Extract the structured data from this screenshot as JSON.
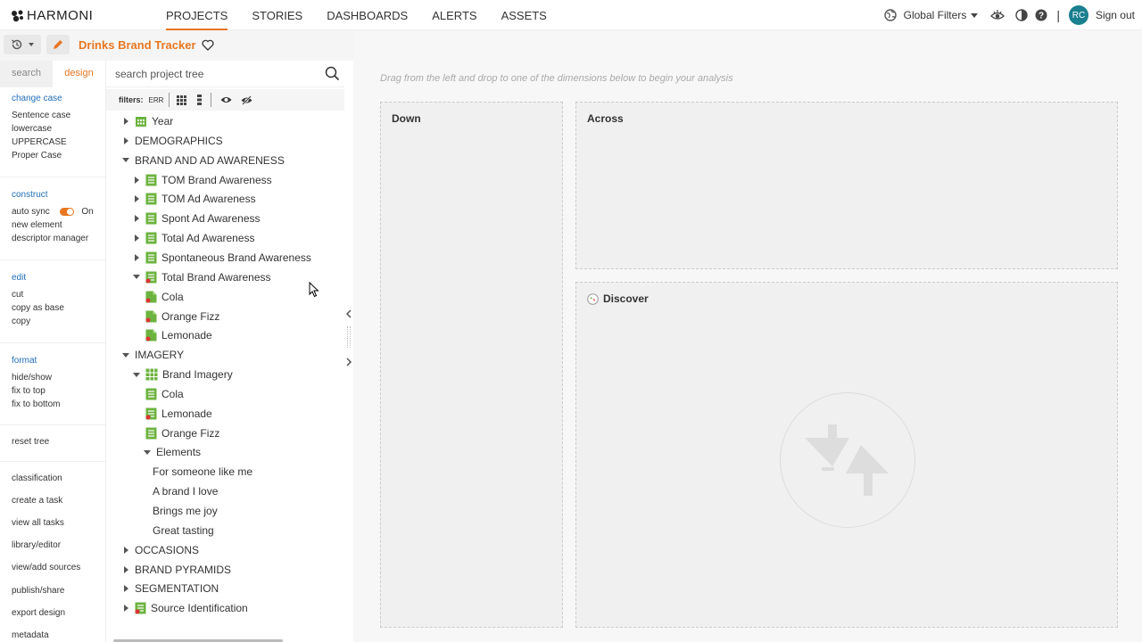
{
  "app": {
    "logo_text": "HARMONI"
  },
  "nav": {
    "tabs": [
      {
        "label": "PROJECTS",
        "active": true
      },
      {
        "label": "STORIES",
        "active": false
      },
      {
        "label": "DASHBOARDS",
        "active": false
      },
      {
        "label": "ALERTS",
        "active": false
      },
      {
        "label": "ASSETS",
        "active": false
      }
    ],
    "global_filters": "Global Filters",
    "separator": "|",
    "user_initials": "RC",
    "sign_out": "Sign out"
  },
  "project": {
    "title": "Drinks Brand Tracker"
  },
  "left_tabs": {
    "search": "search",
    "design": "design"
  },
  "left_menu": {
    "change_case": {
      "head": "change case",
      "items": [
        "Sentence case",
        "lowercase",
        "UPPERCASE",
        "Proper Case"
      ]
    },
    "construct": {
      "head": "construct",
      "auto_sync": "auto sync",
      "auto_sync_state": "On",
      "items": [
        "new element",
        "descriptor manager"
      ]
    },
    "edit": {
      "head": "edit",
      "items": [
        "cut",
        "copy as base",
        "copy"
      ]
    },
    "format": {
      "head": "format",
      "items": [
        "hide/show",
        "fix to top",
        "fix to bottom"
      ]
    },
    "reset_tree": "reset tree",
    "actions": [
      "classification",
      "create a task",
      "view all tasks",
      "library/editor",
      "view/add sources",
      "publish/share",
      "export design",
      "metadata"
    ]
  },
  "tree_search": {
    "placeholder": "search project tree"
  },
  "filters": {
    "label": "filters:",
    "err": "ERR"
  },
  "tree": [
    {
      "label": "Year",
      "arrow": "right",
      "icon": "calendar"
    },
    {
      "label": "DEMOGRAPHICS",
      "arrow": "right",
      "icon": ""
    },
    {
      "label": "BRAND AND AD AWARENESS",
      "arrow": "down",
      "icon": ""
    },
    {
      "label": "TOM Brand Awareness",
      "arrow": "right",
      "icon": "list"
    },
    {
      "label": "TOM Ad Awareness",
      "arrow": "right",
      "icon": "list"
    },
    {
      "label": "Spont Ad Awareness",
      "arrow": "right",
      "icon": "list"
    },
    {
      "label": "Total Ad Awareness",
      "arrow": "right",
      "icon": "list"
    },
    {
      "label": "Spontaneous Brand Awareness",
      "arrow": "right",
      "icon": "list"
    },
    {
      "label": "Total Brand Awareness",
      "arrow": "down",
      "icon": "list-dot"
    },
    {
      "label": "Cola",
      "arrow": "",
      "icon": "doc"
    },
    {
      "label": "Orange Fizz",
      "arrow": "",
      "icon": "doc"
    },
    {
      "label": "Lemonade",
      "arrow": "",
      "icon": "doc"
    },
    {
      "label": "IMAGERY",
      "arrow": "down",
      "icon": ""
    },
    {
      "label": "Brand Imagery",
      "arrow": "down",
      "icon": "grid"
    },
    {
      "label": "Cola",
      "arrow": "",
      "icon": "list"
    },
    {
      "label": "Lemonade",
      "arrow": "",
      "icon": "list-dot"
    },
    {
      "label": "Orange Fizz",
      "arrow": "",
      "icon": "list"
    },
    {
      "label": "Elements",
      "arrow": "down",
      "icon": ""
    },
    {
      "label": "For someone like me",
      "arrow": "",
      "icon": ""
    },
    {
      "label": "A brand I love",
      "arrow": "",
      "icon": ""
    },
    {
      "label": "Brings me joy",
      "arrow": "",
      "icon": ""
    },
    {
      "label": "Great tasting",
      "arrow": "",
      "icon": ""
    },
    {
      "label": "OCCASIONS",
      "arrow": "right",
      "icon": ""
    },
    {
      "label": "BRAND PYRAMIDS",
      "arrow": "right",
      "icon": ""
    },
    {
      "label": "SEGMENTATION",
      "arrow": "right",
      "icon": ""
    },
    {
      "label": "Source Identification",
      "arrow": "right",
      "icon": "list-dot"
    }
  ],
  "analysis": {
    "hint": "Drag from the left and drop to one of the dimensions below to begin your analysis",
    "down_label": "Down",
    "across_label": "Across",
    "discover_label": "Discover"
  },
  "colors": {
    "accent": "#e87722",
    "link": "#1f6eb8",
    "icon_green": "#6db33f",
    "avatar": "#1a7f8f"
  }
}
